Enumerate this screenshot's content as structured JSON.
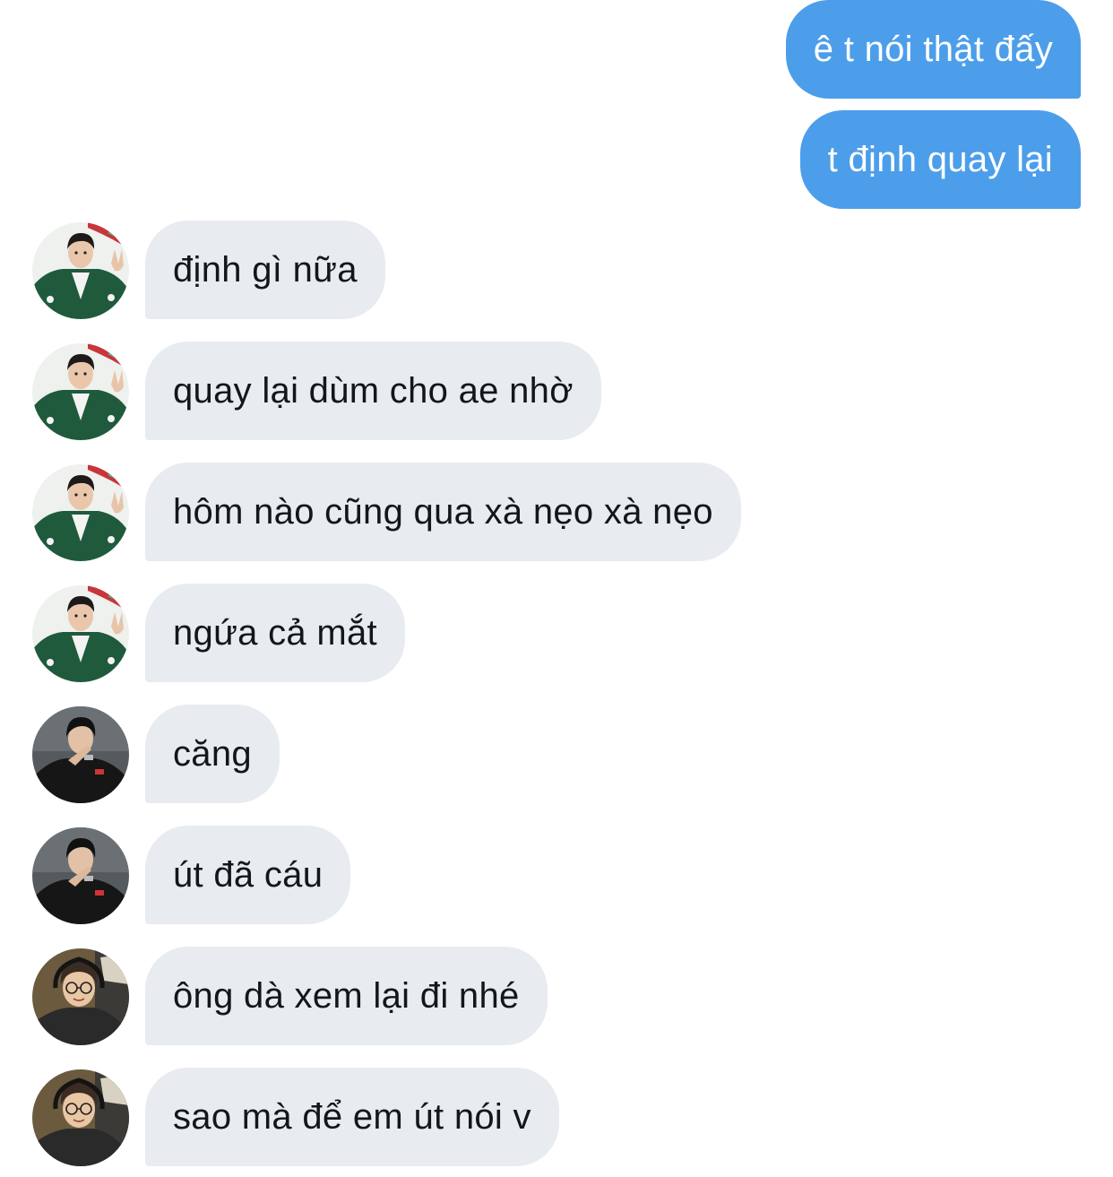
{
  "conversation": {
    "outgoing": [
      "ê t nói thật đấy",
      "t định quay lại"
    ],
    "incoming": [
      {
        "text": "định gì nữa",
        "avatar": "avatar-green-jacket-icon"
      },
      {
        "text": "quay lại dùm cho ae nhờ",
        "avatar": "avatar-green-jacket-icon"
      },
      {
        "text": "hôm nào cũng qua xà nẹo xà nẹo",
        "avatar": "avatar-green-jacket-icon"
      },
      {
        "text": "ngứa cả mắt",
        "avatar": "avatar-green-jacket-icon"
      },
      {
        "text": "căng",
        "avatar": "avatar-black-hoodie-icon"
      },
      {
        "text": "út đã cáu",
        "avatar": "avatar-black-hoodie-icon"
      },
      {
        "text": "ông dà xem lại đi nhé",
        "avatar": "avatar-glasses-headset-icon"
      },
      {
        "text": "sao mà để em út nói v",
        "avatar": "avatar-glasses-headset-icon"
      }
    ]
  },
  "colors": {
    "outgoing_bubble": "#4c9eea",
    "outgoing_text": "#ffffff",
    "incoming_bubble": "#e8ebef",
    "incoming_text": "#14171a",
    "background": "#ffffff"
  }
}
